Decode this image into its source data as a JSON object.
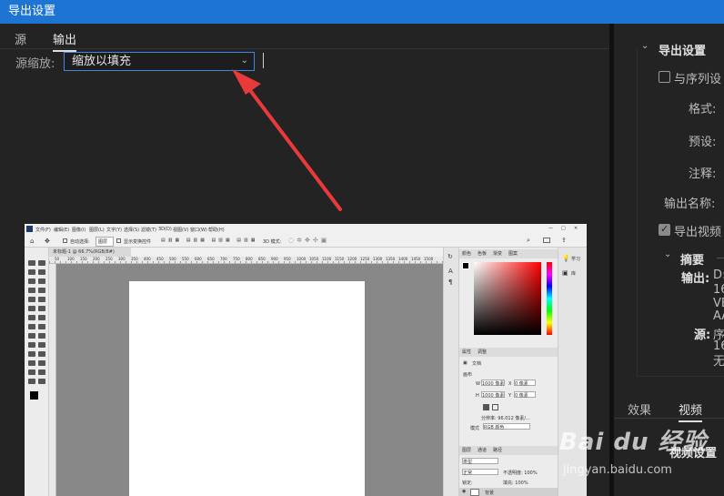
{
  "window": {
    "title": "导出设置"
  },
  "tabs": [
    {
      "label": "源"
    },
    {
      "label": "输出"
    }
  ],
  "source_scale": {
    "label": "源缩放:",
    "value": "缩放以填充"
  },
  "right_panel": {
    "section_title": "导出设置",
    "match_sequence": "与序列设",
    "format_label": "格式:",
    "preset_label": "预设:",
    "comment_label": "注释:",
    "output_name_label": "输出名称:",
    "export_video": "导出视频",
    "summary_title": "摘要",
    "output_label": "输出:",
    "output_lines": [
      "D:",
      "16",
      "VB",
      "AA"
    ],
    "source_label": "源:",
    "source_lines": [
      "序",
      "16",
      "无"
    ],
    "bottom_tabs": [
      "效果",
      "视频"
    ],
    "video_settings": "视频设置"
  },
  "preview": {
    "menu_items": [
      "文件(F)",
      "编辑(E)",
      "图像(I)",
      "图层(L)",
      "文字(Y)",
      "选择(S)",
      "滤镜(T)",
      "3D(D)",
      "视图(V)",
      "窗口(W)",
      "帮助(H)"
    ],
    "window_controls": [
      "—",
      "□",
      "✕"
    ],
    "options_auto_select": "自动选择:",
    "options_layer": "图层",
    "options_transform": "显示变换控件",
    "options_3d_mode": "3D 模式:",
    "doc_tab": "未标题-1 @ 66.7%(RGB/8#)",
    "ruler_numbers": [
      "50",
      "100",
      "150",
      "200",
      "250",
      "300",
      "350",
      "400",
      "450",
      "500",
      "550",
      "600",
      "650",
      "700",
      "750",
      "800",
      "850",
      "900",
      "950",
      "1000",
      "1050",
      "1100",
      "1150",
      "1200",
      "1250",
      "1300",
      "1350",
      "1400",
      "1450",
      "1500"
    ],
    "color_panel_tabs": [
      "颜色",
      "色板",
      "渐变",
      "图案"
    ],
    "right_strip": [
      "学习",
      "库"
    ],
    "properties_tabs": [
      "属性",
      "调整"
    ],
    "properties_doc": "文档",
    "canvas_section": "画布",
    "width_label": "W",
    "width_value": "1000 像素",
    "height_label": "H",
    "height_value": "1000 像素",
    "x_label": "X",
    "x_value": "0 像素",
    "y_label": "Y",
    "y_value": "0 像素",
    "resolution": "分辨率: 96.012 像素/...",
    "mode_label": "模式",
    "mode_value": "RGB 颜色",
    "layers_tabs": [
      "图层",
      "通道",
      "路径"
    ],
    "layers_kind": "类型",
    "layers_normal": "正常",
    "layers_opacity": "不透明度: 100%",
    "layers_lock": "锁定:",
    "layers_fill": "填充: 100%",
    "layer_name": "背景"
  },
  "watermark": {
    "brand": "Bai du 经验",
    "url": "jingyan.baidu.com"
  },
  "colors": {
    "title_bar": "#1e74d2",
    "background": "#232323",
    "select_border": "#3a89e0",
    "arrow": "#e83a3a"
  }
}
